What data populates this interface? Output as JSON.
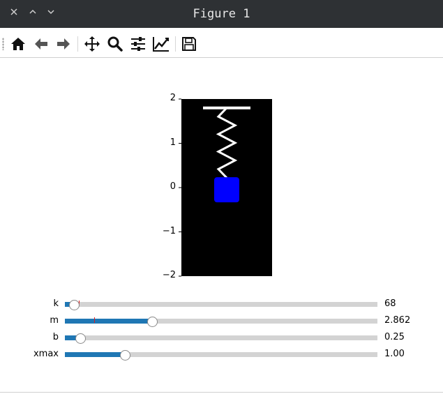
{
  "window": {
    "title": "Figure 1",
    "controls": [
      "close",
      "maximize",
      "minimize"
    ]
  },
  "toolbar": {
    "buttons": [
      {
        "name": "home",
        "icon": "home-icon"
      },
      {
        "name": "back",
        "icon": "arrow-left-icon"
      },
      {
        "name": "forward",
        "icon": "arrow-right-icon"
      },
      {
        "name": "pan",
        "icon": "move-icon"
      },
      {
        "name": "zoom",
        "icon": "magnifier-icon"
      },
      {
        "name": "configure-subplots",
        "icon": "sliders-icon"
      },
      {
        "name": "edit-axes",
        "icon": "line-chart-icon"
      },
      {
        "name": "save",
        "icon": "floppy-disk-icon"
      }
    ]
  },
  "plot": {
    "ylim": [
      -2,
      2
    ],
    "yticks": [
      "2",
      "1",
      "0",
      "−1",
      "−2"
    ],
    "background_color": "#000000",
    "spring_color": "#ffffff",
    "mass_color": "#0000ff",
    "mass_center_y": -0.05,
    "ceiling_y": 1.8,
    "spring_bottom_y": 0.22
  },
  "sliders": [
    {
      "label": "k",
      "value_text": "68",
      "fraction": 0.03,
      "init_fraction": 0.045
    },
    {
      "label": "m",
      "value_text": "2.862",
      "fraction": 0.28,
      "init_fraction": 0.094
    },
    {
      "label": "b",
      "value_text": "0.25",
      "fraction": 0.05,
      "init_fraction": null
    },
    {
      "label": "xmax",
      "value_text": "1.00",
      "fraction": 0.193,
      "init_fraction": null
    }
  ],
  "colors": {
    "titlebar": "#2e3134",
    "slider_fill": "#1f77b4",
    "slider_track": "#d3d3d3",
    "init_marker": "#e02020"
  }
}
